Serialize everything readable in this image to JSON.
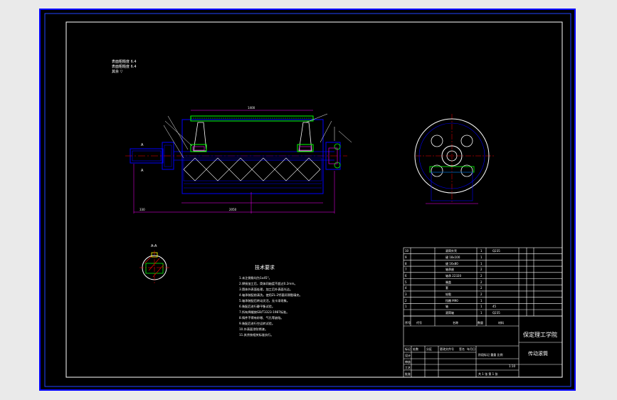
{
  "notes_top": [
    "表面粗糙度 6.4",
    "表面粗糙度 6.4",
    "其余 ▽"
  ],
  "tech_requirements": {
    "title": "技术要求",
    "items": [
      "1.未注倒角均为1x45°。",
      "2.焊接加工后，筒体同轴度不超过0.2mm。",
      "3.筒体外表面处理，加工后外表面光洁。",
      "4.轴承装配前清洗，使用ZL-2钙基润滑脂填充。",
      "5.轴承装配后转动灵活，无卡滞现象。",
      "6.装配后进行静平衡试验。",
      "7.所有焊缝按GB/T3323-1987标准。",
      "8.铸件不得有砂眼、气孔等缺陷。",
      "9.装配后进行空运转试验。",
      "10.外表面涂防锈漆。",
      "11.其余按相关标准执行。"
    ]
  },
  "parts_list": [
    {
      "no": "10",
      "name": "滚筒外壳",
      "qty": "1",
      "material": "Q235"
    },
    {
      "no": "9",
      "name": "键 18x100",
      "qty": "1",
      "material": ""
    },
    {
      "no": "8",
      "name": "键 16x80",
      "qty": "1",
      "material": ""
    },
    {
      "no": "7",
      "name": "轴承座",
      "qty": "2",
      "material": ""
    },
    {
      "no": "6",
      "name": "轴承 22320",
      "qty": "2",
      "material": ""
    },
    {
      "no": "5",
      "name": "端盖",
      "qty": "2",
      "material": ""
    },
    {
      "no": "4",
      "name": "套",
      "qty": "2",
      "material": ""
    },
    {
      "no": "3",
      "name": "轮毂",
      "qty": "2",
      "material": ""
    },
    {
      "no": "2",
      "name": "挡圈 M90",
      "qty": "1",
      "material": ""
    },
    {
      "no": "1",
      "name": "轴",
      "qty": "1",
      "material": "45"
    },
    {
      "no": "",
      "name": "滚筒轴",
      "qty": "1",
      "material": "Q235"
    }
  ],
  "parts_header": {
    "no": "序号",
    "code": "代号",
    "name": "名称",
    "qty": "数量",
    "material": "材料"
  },
  "title_block": {
    "school": "保定理工学院",
    "drawing_name": "传动滚筒",
    "scale": "1:10",
    "sheet": "共 1 张  第 1 张",
    "roles": [
      "设计",
      "审核",
      "工艺",
      "批准"
    ],
    "stage_label": "阶段标记  重量  比例",
    "marks": [
      "标记",
      "处数",
      "分区",
      "更改文件号",
      "签名",
      "年月日"
    ]
  },
  "dimension_labels": {
    "total_length": "2050",
    "drum_length": "1400",
    "shaft_end": "330"
  },
  "colors": {
    "background": "#000000",
    "frame": "#ffffff",
    "outer_border": "#0000ff",
    "geometry": "#0000ff",
    "lagging": "#00ff00",
    "hatch": "#ff0000",
    "dimension": "#ff00ff",
    "leader": "#ffffff",
    "accent": "#ffff00",
    "panel": "#eaeaea"
  }
}
